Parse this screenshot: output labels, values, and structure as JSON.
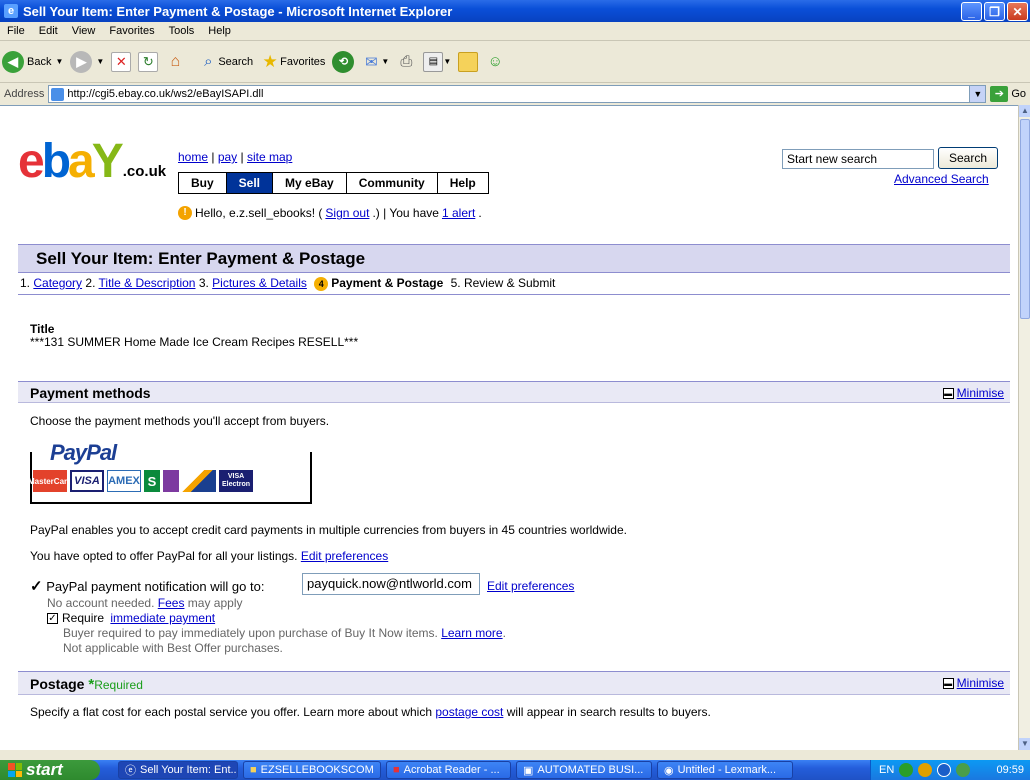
{
  "window": {
    "title": "Sell Your Item: Enter Payment & Postage - Microsoft Internet Explorer"
  },
  "menu": [
    "File",
    "Edit",
    "View",
    "Favorites",
    "Tools",
    "Help"
  ],
  "toolbar": {
    "back": "Back",
    "search": "Search",
    "favorites": "Favorites"
  },
  "address": {
    "label": "Address",
    "url": "http://cgi5.ebay.co.uk/ws2/eBayISAPI.dll",
    "go": "Go"
  },
  "header": {
    "logo_suffix": ".co.uk",
    "links": {
      "home": "home",
      "pay": "pay",
      "site_map": "site map"
    },
    "tabs": [
      "Buy",
      "Sell",
      "My eBay",
      "Community",
      "Help"
    ],
    "search_placeholder": "Start new search",
    "search_button": "Search",
    "advanced_search": "Advanced Search",
    "hello_prefix": "Hello, e.z.sell_ebooks! (",
    "sign_out": "Sign out",
    "hello_mid": ".) | You have ",
    "alert": "1 alert",
    "hello_suffix": "."
  },
  "page_title": "Sell Your Item: Enter Payment & Postage",
  "steps": {
    "s1_num": "1.",
    "s1": "Category",
    "s2_num": "2.",
    "s2": "Title & Description",
    "s3_num": "3.",
    "s3": "Pictures & Details",
    "s4_num": "4",
    "s4": "Payment & Postage",
    "s5_num": "5.",
    "s5": "Review & Submit"
  },
  "item": {
    "title_label": "Title",
    "title_value": "***131 SUMMER Home Made Ice Cream Recipes RESELL***"
  },
  "payment": {
    "heading": "Payment methods",
    "minimise": "Minimise",
    "intro": "Choose the payment methods you'll accept from buyers.",
    "paypal_logo": "PayPal",
    "cards": [
      "MasterCard",
      "VISA",
      "AMEX",
      "S",
      "",
      "",
      "VISA Electron"
    ],
    "desc": "PayPal enables you to accept credit card payments in multiple currencies from buyers in 45 countries worldwide.",
    "opted": "You have opted to offer PayPal for all your listings.",
    "edit_prefs": "Edit preferences",
    "notify_label": "PayPal payment notification will go to:",
    "email": "payquick.now@ntlworld.com",
    "edit_prefs2": "Edit preferences",
    "no_account": "No account needed.",
    "fees": "Fees",
    "may_apply": "may apply",
    "require": "Require",
    "immediate_payment": "immediate payment",
    "buyer_required": "Buyer required to pay immediately upon purchase of Buy It Now items.",
    "learn_more": "Learn more",
    "learn_more_suffix": ".",
    "not_applicable": "Not applicable with Best Offer purchases."
  },
  "postage": {
    "heading": "Postage",
    "required": "Required",
    "minimise": "Minimise",
    "desc_prefix": "Specify a flat cost for each postal service you offer. Learn more about which",
    "postage_cost": "postage cost",
    "desc_suffix": "will appear in search results to buyers."
  },
  "taskbar": {
    "start": "start",
    "tasks": [
      "Sell Your Item: Ent...",
      "EZSELLEBOOKSCOM",
      "Acrobat Reader - ...",
      "AUTOMATED BUSI...",
      "Untitled - Lexmark..."
    ],
    "lang": "EN",
    "time": "09:59"
  }
}
